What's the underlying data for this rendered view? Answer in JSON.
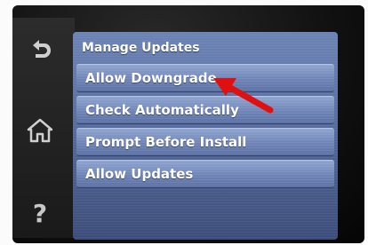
{
  "panel": {
    "back_icon": "back-arrow-icon",
    "home_icon": "home-icon",
    "help_icon": "help-question-icon"
  },
  "screen": {
    "title": "Manage Updates",
    "menu_items": [
      {
        "label": "Allow Downgrade"
      },
      {
        "label": "Check Automatically"
      },
      {
        "label": "Prompt Before Install"
      },
      {
        "label": "Allow Updates"
      }
    ]
  },
  "annotation": {
    "type": "red-arrow",
    "color": "#e01010",
    "points_to": "Allow Downgrade"
  },
  "colors": {
    "screen_blue": "#5a6fa0",
    "item_blue": "#7a8fc0",
    "text": "#ffffff",
    "arrow": "#e01010"
  }
}
